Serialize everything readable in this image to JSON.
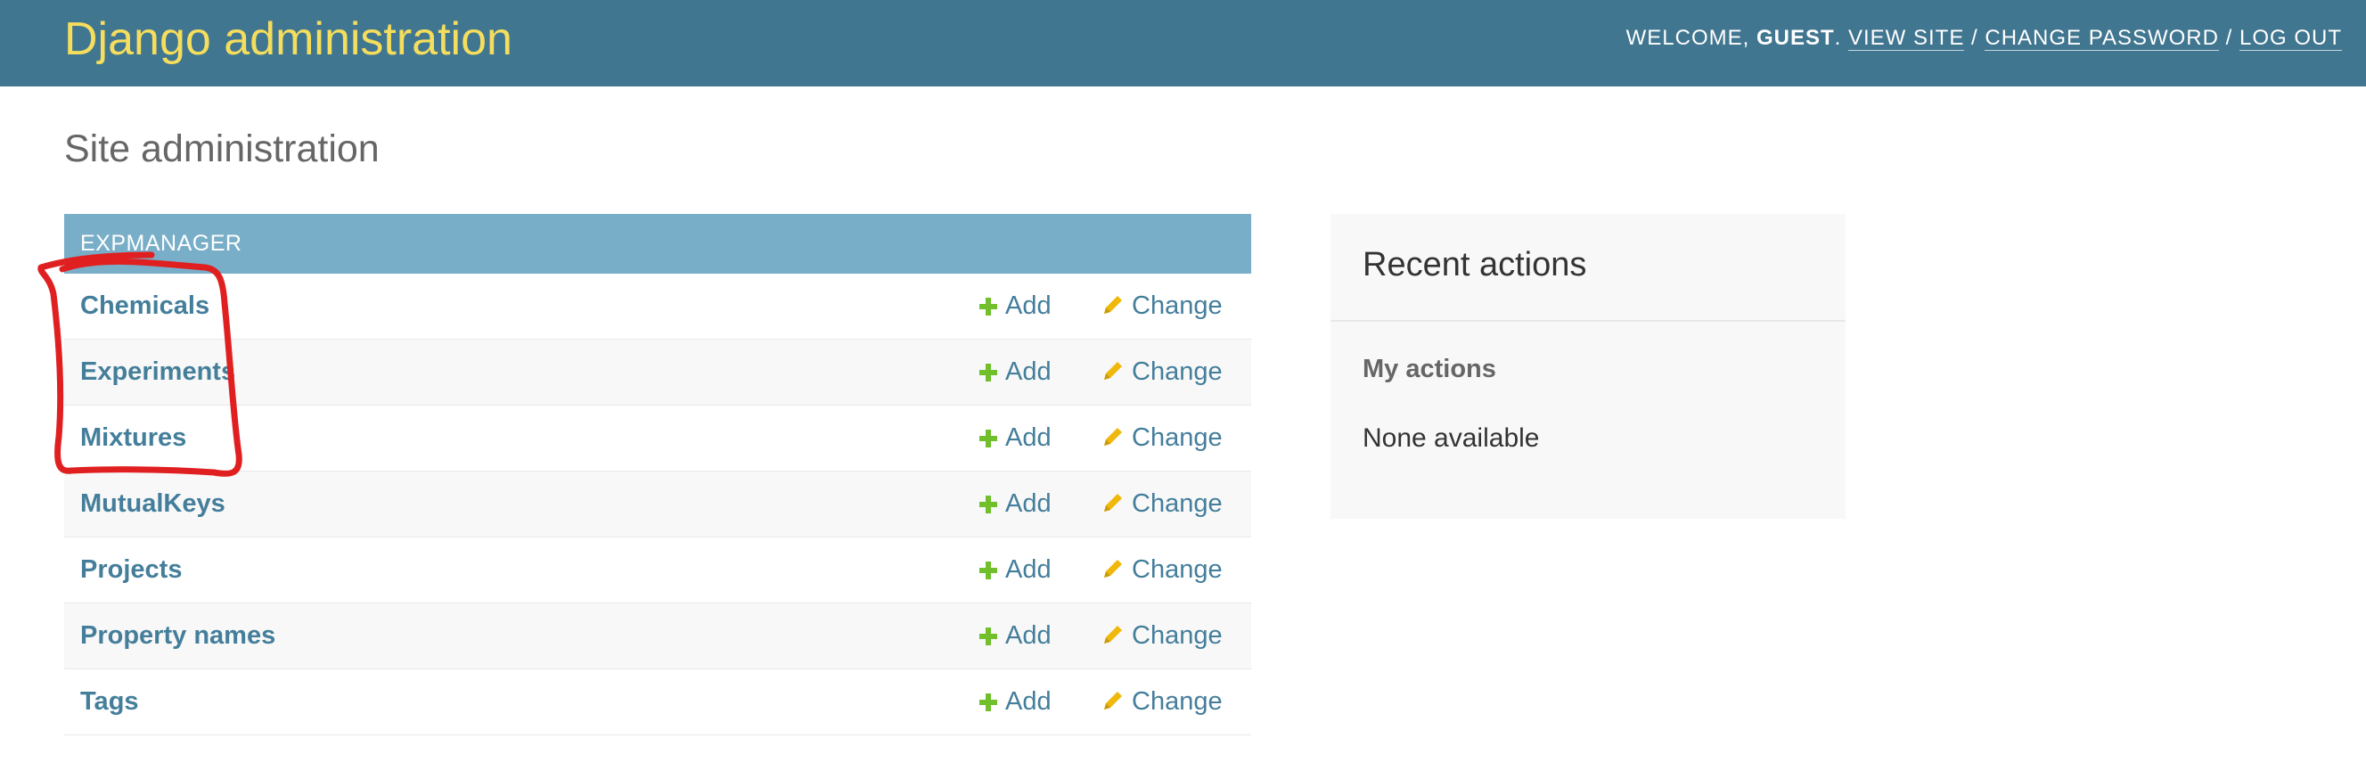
{
  "header": {
    "branding": "Django administration",
    "welcome": "Welcome,",
    "user": "Guest",
    "view_site": "View site",
    "change_password": "Change password",
    "log_out": "Log out",
    "sep": "/"
  },
  "content": {
    "title": "Site administration"
  },
  "app": {
    "caption": "Expmanager",
    "add_label": "Add",
    "change_label": "Change",
    "models": [
      "Chemicals",
      "Experiments",
      "Mixtures",
      "MutualKeys",
      "Projects",
      "Property names",
      "Tags"
    ]
  },
  "recent": {
    "title": "Recent actions",
    "subtitle": "My actions",
    "empty": "None available"
  },
  "colors": {
    "header_bg": "#417690",
    "branding": "#f5dd5d",
    "caption_bg": "#79aec8",
    "link": "#447e9b",
    "add_icon": "#70bf2b",
    "change_icon": "#efb80b",
    "annotation": "#e02020"
  },
  "icons": {
    "add": "plus-icon",
    "change": "pencil-icon"
  }
}
